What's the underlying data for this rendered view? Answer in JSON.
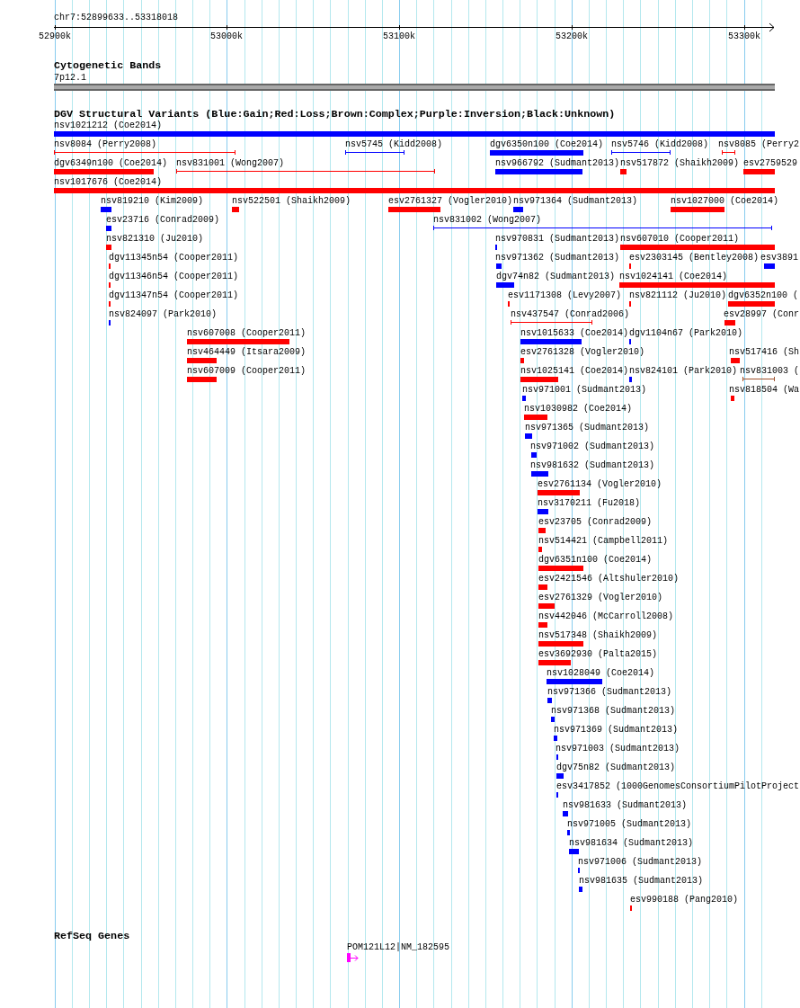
{
  "ruler": {
    "region": "chr7:52899633..53318018",
    "ticks": [
      "52900k",
      "53000k",
      "53100k",
      "53200k",
      "53300k"
    ]
  },
  "cytogenetic_bands": {
    "title": "Cytogenetic Bands",
    "band": "7p12.1"
  },
  "dgv_variants": {
    "title": "DGV Structural Variants (Blue:Gain;Red:Loss;Brown:Complex;Purple:Inversion;Black:Unknown)",
    "items": [
      {
        "label": "nsv1021212 (Coe2014)",
        "color": "#0000ff",
        "kind": "bar"
      },
      {
        "label": "nsv8084 (Perry2008)",
        "color": "#ff0000",
        "kind": "range"
      },
      {
        "label": "nsv5745 (Kidd2008)",
        "color": "#0000ff",
        "kind": "range"
      },
      {
        "label": "dgv6350n100 (Coe2014)",
        "color": "#0000ff",
        "kind": "bar"
      },
      {
        "label": "nsv5746 (Kidd2008)",
        "color": "#0000ff",
        "kind": "range"
      },
      {
        "label": "nsv8085 (Perry2",
        "color": "#ff0000",
        "kind": "range"
      },
      {
        "label": "dgv6349n100 (Coe2014)",
        "color": "#ff0000",
        "kind": "bar"
      },
      {
        "label": "nsv831001 (Wong2007)",
        "color": "#ff0000",
        "kind": "range"
      },
      {
        "label": "nsv966792 (Sudmant2013)",
        "color": "#0000ff",
        "kind": "bar"
      },
      {
        "label": "nsv517872 (Shaikh2009)",
        "color": "#ff0000",
        "kind": "bar"
      },
      {
        "label": "esv2759529",
        "color": "#ff0000",
        "kind": "bar"
      },
      {
        "label": "nsv1017676 (Coe2014)",
        "color": "#ff0000",
        "kind": "bar"
      },
      {
        "label": "nsv819210 (Kim2009)",
        "color": "#0000ff",
        "kind": "bar"
      },
      {
        "label": "nsv522501 (Shaikh2009)",
        "color": "#ff0000",
        "kind": "bar"
      },
      {
        "label": "esv2761327 (Vogler2010)",
        "color": "#ff0000",
        "kind": "bar"
      },
      {
        "label": "nsv971364 (Sudmant2013)",
        "color": "#0000ff",
        "kind": "bar"
      },
      {
        "label": "nsv1027000 (Coe2014)",
        "color": "#ff0000",
        "kind": "bar"
      },
      {
        "label": "esv23716 (Conrad2009)",
        "color": "#0000ff",
        "kind": "bar"
      },
      {
        "label": "nsv831002 (Wong2007)",
        "color": "#0000ff",
        "kind": "range"
      },
      {
        "label": "nsv821310 (Ju2010)",
        "color": "#ff0000",
        "kind": "bar"
      },
      {
        "label": "nsv970831 (Sudmant2013)",
        "color": "#0000ff",
        "kind": "bar"
      },
      {
        "label": "nsv607010 (Cooper2011)",
        "color": "#ff0000",
        "kind": "bar"
      },
      {
        "label": "dgv11345n54 (Cooper2011)",
        "color": "#ff0000",
        "kind": "bar"
      },
      {
        "label": "nsv971362 (Sudmant2013)",
        "color": "#0000ff",
        "kind": "bar"
      },
      {
        "label": "esv2303145 (Bentley2008)",
        "color": "#ff0000",
        "kind": "bar"
      },
      {
        "label": "esv3891",
        "color": "#0000ff",
        "kind": "bar"
      },
      {
        "label": "dgv11346n54 (Cooper2011)",
        "color": "#ff0000",
        "kind": "bar"
      },
      {
        "label": "dgv74n82 (Sudmant2013)",
        "color": "#0000ff",
        "kind": "bar"
      },
      {
        "label": "nsv1024141 (Coe2014)",
        "color": "#ff0000",
        "kind": "bar"
      },
      {
        "label": "dgv11347n54 (Cooper2011)",
        "color": "#ff0000",
        "kind": "bar"
      },
      {
        "label": "esv1171308 (Levy2007)",
        "color": "#ff0000",
        "kind": "bar"
      },
      {
        "label": "nsv821112 (Ju2010)",
        "color": "#ff0000",
        "kind": "bar"
      },
      {
        "label": "dgv6352n100 (",
        "color": "#ff0000",
        "kind": "bar"
      },
      {
        "label": "nsv824097 (Park2010)",
        "color": "#0000ff",
        "kind": "bar"
      },
      {
        "label": "nsv437547 (Conrad2006)",
        "color": "#ff0000",
        "kind": "range"
      },
      {
        "label": "esv28997 (Conr",
        "color": "#ff0000",
        "kind": "bar"
      },
      {
        "label": "nsv607008 (Cooper2011)",
        "color": "#ff0000",
        "kind": "bar"
      },
      {
        "label": "nsv1015633 (Coe2014)",
        "color": "#0000ff",
        "kind": "bar"
      },
      {
        "label": "dgv1104n67 (Park2010)",
        "color": "#0000ff",
        "kind": "bar"
      },
      {
        "label": "nsv464449 (Itsara2009)",
        "color": "#ff0000",
        "kind": "bar"
      },
      {
        "label": "esv2761328 (Vogler2010)",
        "color": "#ff0000",
        "kind": "bar"
      },
      {
        "label": "nsv517416 (Sh",
        "color": "#ff0000",
        "kind": "bar"
      },
      {
        "label": "nsv607009 (Cooper2011)",
        "color": "#ff0000",
        "kind": "bar"
      },
      {
        "label": "nsv1025141 (Coe2014)",
        "color": "#ff0000",
        "kind": "bar"
      },
      {
        "label": "nsv824101 (Park2010)",
        "color": "#0000ff",
        "kind": "bar"
      },
      {
        "label": "nsv831003 (",
        "color": "#a0522d",
        "kind": "range"
      },
      {
        "label": "nsv971001 (Sudmant2013)",
        "color": "#0000ff",
        "kind": "bar"
      },
      {
        "label": "nsv818504 (Wa",
        "color": "#ff0000",
        "kind": "bar"
      },
      {
        "label": "nsv1030982 (Coe2014)",
        "color": "#ff0000",
        "kind": "bar"
      },
      {
        "label": "nsv971365 (Sudmant2013)",
        "color": "#0000ff",
        "kind": "bar"
      },
      {
        "label": "nsv971002 (Sudmant2013)",
        "color": "#0000ff",
        "kind": "bar"
      },
      {
        "label": "nsv981632 (Sudmant2013)",
        "color": "#0000ff",
        "kind": "bar"
      },
      {
        "label": "esv2761134 (Vogler2010)",
        "color": "#ff0000",
        "kind": "bar"
      },
      {
        "label": "nsv3170211 (Fu2018)",
        "color": "#0000ff",
        "kind": "bar"
      },
      {
        "label": "esv23705 (Conrad2009)",
        "color": "#ff0000",
        "kind": "bar"
      },
      {
        "label": "nsv514421 (Campbell2011)",
        "color": "#ff0000",
        "kind": "bar"
      },
      {
        "label": "dgv6351n100 (Coe2014)",
        "color": "#ff0000",
        "kind": "bar"
      },
      {
        "label": "esv2421546 (Altshuler2010)",
        "color": "#ff0000",
        "kind": "bar"
      },
      {
        "label": "esv2761329 (Vogler2010)",
        "color": "#ff0000",
        "kind": "bar"
      },
      {
        "label": "nsv442046 (McCarroll2008)",
        "color": "#ff0000",
        "kind": "bar"
      },
      {
        "label": "nsv517348 (Shaikh2009)",
        "color": "#ff0000",
        "kind": "bar"
      },
      {
        "label": "esv3692930 (Palta2015)",
        "color": "#ff0000",
        "kind": "bar"
      },
      {
        "label": "nsv1028049 (Coe2014)",
        "color": "#0000ff",
        "kind": "bar"
      },
      {
        "label": "nsv971366 (Sudmant2013)",
        "color": "#0000ff",
        "kind": "bar"
      },
      {
        "label": "nsv971368 (Sudmant2013)",
        "color": "#0000ff",
        "kind": "bar"
      },
      {
        "label": "nsv971369 (Sudmant2013)",
        "color": "#0000ff",
        "kind": "bar"
      },
      {
        "label": "nsv971003 (Sudmant2013)",
        "color": "#0000ff",
        "kind": "bar"
      },
      {
        "label": "dgv75n82 (Sudmant2013)",
        "color": "#0000ff",
        "kind": "bar"
      },
      {
        "label": "esv3417852 (1000GenomesConsortiumPilotProject",
        "color": "#0000ff",
        "kind": "bar"
      },
      {
        "label": "nsv981633 (Sudmant2013)",
        "color": "#0000ff",
        "kind": "bar"
      },
      {
        "label": "nsv971005 (Sudmant2013)",
        "color": "#0000ff",
        "kind": "bar"
      },
      {
        "label": "nsv981634 (Sudmant2013)",
        "color": "#0000ff",
        "kind": "bar"
      },
      {
        "label": "nsv971006 (Sudmant2013)",
        "color": "#0000ff",
        "kind": "bar"
      },
      {
        "label": "nsv981635 (Sudmant2013)",
        "color": "#0000ff",
        "kind": "bar"
      },
      {
        "label": "esv990188 (Pang2010)",
        "color": "#ff0000",
        "kind": "bar"
      }
    ]
  },
  "refseq_genes": {
    "title": "RefSeq Genes",
    "genes": [
      {
        "label": "POM121L12|NM_182595"
      }
    ]
  }
}
